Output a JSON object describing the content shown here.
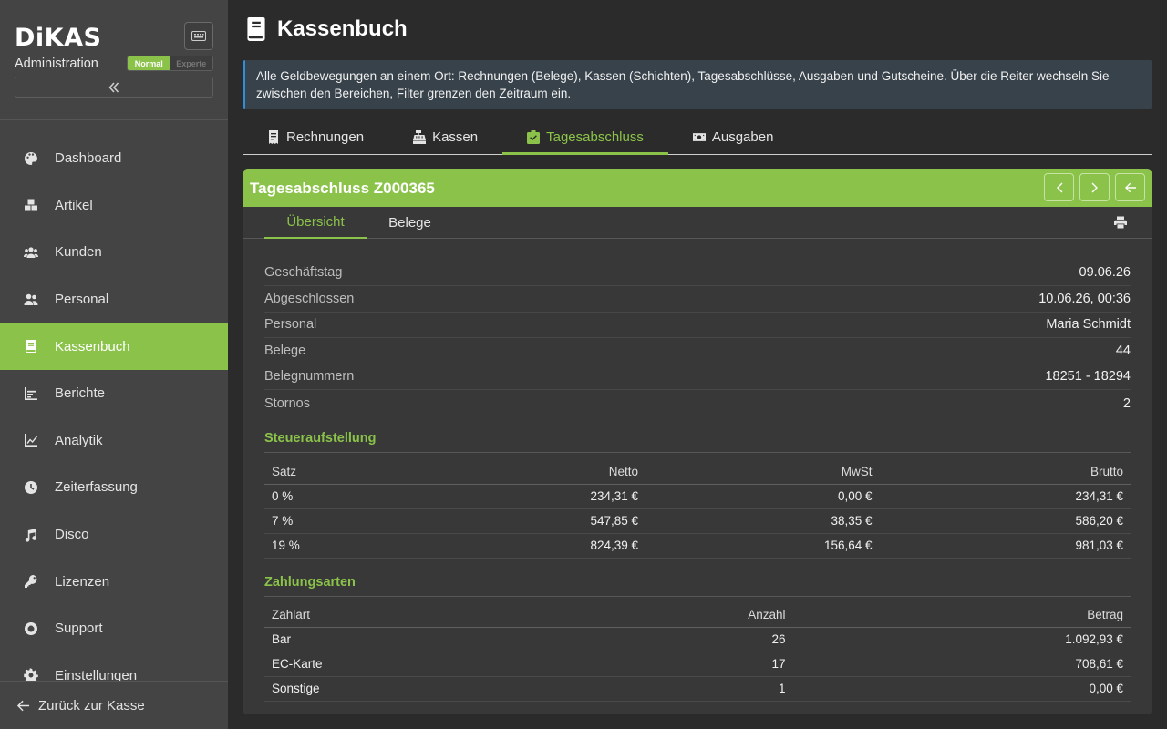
{
  "sidebar": {
    "brand": "DiKAS",
    "subtitle": "Administration",
    "mode_normal": "Normal",
    "mode_expert": "Experte",
    "items": [
      {
        "label": "Dashboard",
        "icon": "palette-icon"
      },
      {
        "label": "Artikel",
        "icon": "boxes-icon"
      },
      {
        "label": "Kunden",
        "icon": "users-icon"
      },
      {
        "label": "Personal",
        "icon": "user-group-icon"
      },
      {
        "label": "Kassenbuch",
        "icon": "book-icon",
        "active": true
      },
      {
        "label": "Berichte",
        "icon": "bar-chart-icon"
      },
      {
        "label": "Analytik",
        "icon": "line-chart-icon"
      },
      {
        "label": "Zeiterfassung",
        "icon": "clock-icon"
      },
      {
        "label": "Disco",
        "icon": "music-icon"
      },
      {
        "label": "Lizenzen",
        "icon": "key-icon"
      },
      {
        "label": "Support",
        "icon": "lifebuoy-icon"
      },
      {
        "label": "Einstellungen",
        "icon": "gear-icon"
      }
    ],
    "back_label": "Zurück zur Kasse"
  },
  "header": {
    "title": "Kassenbuch",
    "info": "Alle Geldbewegungen an einem Ort: Rechnungen (Belege), Kassen (Schichten), Tagesabschlüsse, Ausgaben und Gutscheine. Über die Reiter wechseln Sie zwischen den Bereichen, Filter grenzen den Zeitraum ein."
  },
  "tabs": [
    {
      "label": "Rechnungen",
      "icon": "receipt-icon"
    },
    {
      "label": "Kassen",
      "icon": "cash-register-icon"
    },
    {
      "label": "Tagesabschluss",
      "icon": "clipboard-check-icon",
      "active": true
    },
    {
      "label": "Ausgaben",
      "icon": "money-bill-icon"
    }
  ],
  "card": {
    "title": "Tagesabschluss Z000365",
    "subtabs": [
      "Übersicht",
      "Belege"
    ],
    "details": [
      {
        "key": "Geschäftstag",
        "value": "09.06.26"
      },
      {
        "key": "Abgeschlossen",
        "value": "10.06.26, 00:36"
      },
      {
        "key": "Personal",
        "value": "Maria Schmidt"
      },
      {
        "key": "Belege",
        "value": "44"
      },
      {
        "key": "Belegnummern",
        "value": "18251 - 18294"
      },
      {
        "key": "Stornos",
        "value": "2"
      }
    ],
    "tax": {
      "title": "Steueraufstellung",
      "headers": [
        "Satz",
        "Netto",
        "MwSt",
        "Brutto"
      ],
      "rows": [
        [
          "0 %",
          "234,31 €",
          "0,00 €",
          "234,31 €"
        ],
        [
          "7 %",
          "547,85 €",
          "38,35 €",
          "586,20 €"
        ],
        [
          "19 %",
          "824,39 €",
          "156,64 €",
          "981,03 €"
        ]
      ]
    },
    "payments": {
      "title": "Zahlungsarten",
      "headers": [
        "Zahlart",
        "Anzahl",
        "Betrag"
      ],
      "rows": [
        [
          "Bar",
          "26",
          "1.092,93 €"
        ],
        [
          "EC-Karte",
          "17",
          "708,61 €"
        ],
        [
          "Sonstige",
          "1",
          "0,00 €"
        ]
      ]
    }
  },
  "colors": {
    "accent": "#8bc34a",
    "info_border": "#2f8fd8"
  }
}
